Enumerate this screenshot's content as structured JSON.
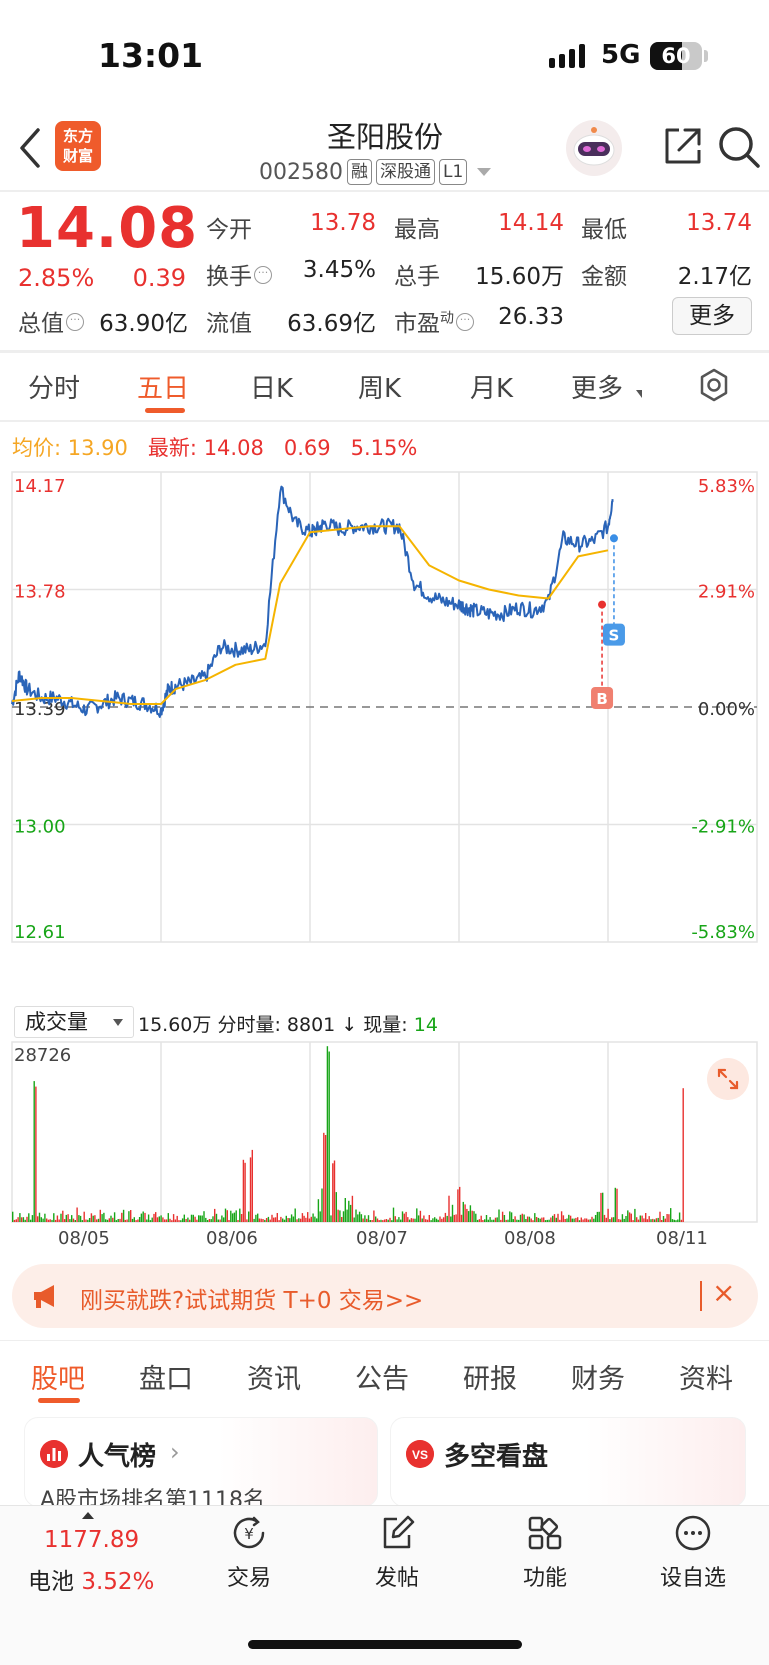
{
  "status_bar": {
    "time": "13:01",
    "network": "5G",
    "battery": "60"
  },
  "header": {
    "logo_text": "东方财富",
    "stock_name": "圣阳股份",
    "stock_code": "002580",
    "tags": [
      "融",
      "深股通",
      "L1"
    ]
  },
  "quote": {
    "price": "14.08",
    "change_pct": "2.85%",
    "change": "0.39",
    "fields": [
      {
        "label": "今开",
        "value": "13.78"
      },
      {
        "label": "最高",
        "value": "14.14"
      },
      {
        "label": "最低",
        "value": "13.74"
      },
      {
        "label": "换手",
        "value": "3.45%"
      },
      {
        "label": "总手",
        "value": "15.60万"
      },
      {
        "label": "金额",
        "value": "2.17亿"
      },
      {
        "label": "总值",
        "value": "63.90亿"
      },
      {
        "label": "流值",
        "value": "63.69亿"
      },
      {
        "label": "市盈",
        "sup": "动",
        "value": "26.33"
      }
    ],
    "more": "更多"
  },
  "tabs": [
    "分时",
    "五日",
    "日K",
    "周K",
    "月K",
    "更多"
  ],
  "active_tab": "五日",
  "legend": {
    "avg_label": "均价:",
    "avg_value": "13.90",
    "latest_label": "最新:",
    "latest_value": "14.08",
    "latest_change": "0.69",
    "latest_pct": "5.15%"
  },
  "volume_header": {
    "selector": "成交量",
    "total": "15.60万",
    "period_label": "分时量:",
    "period_value": "8801",
    "arrow": "↓",
    "now_label": "现量:",
    "now_value": "14",
    "max_label": "28726"
  },
  "chart_data": {
    "type": "line",
    "title": "",
    "y_left_ticks": [
      "14.17",
      "13.78",
      "13.39",
      "13.00",
      "12.61"
    ],
    "y_right_ticks": [
      "5.83%",
      "2.91%",
      "0.00%",
      "-2.91%",
      "-5.83%"
    ],
    "ylim": [
      12.61,
      14.17
    ],
    "prev_close": 13.39,
    "x_labels": [
      "08/05",
      "08/06",
      "08/07",
      "08/08",
      "08/11"
    ],
    "markers": [
      {
        "label": "B",
        "color": "#e8312f"
      },
      {
        "label": "S",
        "color": "#3a8ee6"
      }
    ],
    "series": [
      {
        "name": "",
        "color": "#2a64b8",
        "x": [
          0,
          0.05,
          0.1,
          0.2,
          0.3,
          0.4,
          0.5,
          0.6,
          0.7,
          0.8,
          0.9,
          1.0,
          1.05,
          1.1,
          1.2,
          1.3,
          1.4,
          1.5,
          1.6,
          1.7,
          1.8,
          1.9,
          2.0,
          2.05,
          2.1,
          2.2,
          2.3,
          2.4,
          2.5,
          2.6,
          2.7,
          2.8,
          2.9,
          3.0,
          3.05,
          3.1,
          3.2,
          3.3,
          3.4,
          3.5,
          3.6,
          3.7,
          3.8,
          3.9,
          4.0,
          4.03,
          4.1,
          4.2,
          4.3,
          4.4,
          4.5
        ],
        "values": [
          13.4,
          13.5,
          13.45,
          13.42,
          13.42,
          13.4,
          13.38,
          13.4,
          13.42,
          13.41,
          13.4,
          13.38,
          13.45,
          13.46,
          13.47,
          13.49,
          13.59,
          13.58,
          13.58,
          13.6,
          14.12,
          14.0,
          13.97,
          13.98,
          14.0,
          13.98,
          13.99,
          13.99,
          13.99,
          13.99,
          13.8,
          13.76,
          13.74,
          13.73,
          13.72,
          13.71,
          13.7,
          13.7,
          13.72,
          13.71,
          13.74,
          13.95,
          13.93,
          13.94,
          13.99,
          14.08,
          14.08,
          14.08,
          14.08,
          14.08,
          14.08
        ]
      },
      {
        "name": "",
        "color": "#f5b400",
        "x": [
          0,
          0.2,
          0.4,
          0.6,
          0.8,
          1.0,
          1.1,
          1.3,
          1.5,
          1.7,
          1.8,
          2.0,
          2.2,
          2.4,
          2.6,
          2.8,
          3.0,
          3.2,
          3.4,
          3.6,
          3.8,
          4.0
        ],
        "values": [
          13.41,
          13.42,
          13.42,
          13.41,
          13.4,
          13.4,
          13.45,
          13.48,
          13.53,
          13.55,
          13.8,
          13.97,
          13.98,
          13.99,
          13.99,
          13.86,
          13.81,
          13.78,
          13.76,
          13.75,
          13.89,
          13.91
        ]
      }
    ]
  },
  "volume_chart": {
    "type": "bar",
    "ymax": 28726,
    "up_color": "#e8312f",
    "down_color": "#18a518"
  },
  "ad": {
    "text": "刚买就跌?试试期货 T+0 交易>>",
    "close": "×"
  },
  "bottom_tabs": [
    "股吧",
    "盘口",
    "资讯",
    "公告",
    "研报",
    "财务",
    "资料"
  ],
  "active_bottom_tab": "股吧",
  "cards": [
    {
      "title": "人气榜",
      "subtitle": "A股市场排名第1118名"
    },
    {
      "title": "多空看盘",
      "subtitle": ""
    }
  ],
  "bottom_bar": {
    "index_value": "1177.89",
    "index_name": "电池",
    "index_pct": "3.52%",
    "items": [
      "交易",
      "发帖",
      "功能",
      "设自选"
    ]
  }
}
